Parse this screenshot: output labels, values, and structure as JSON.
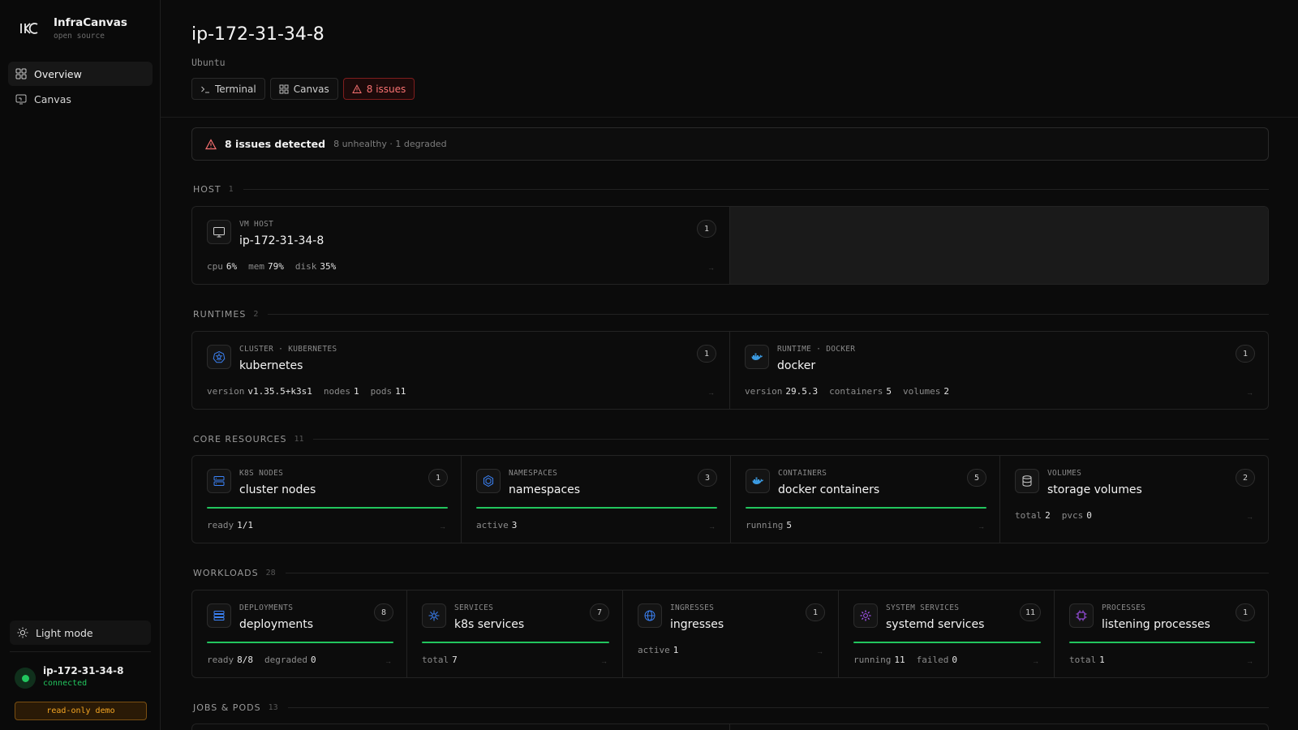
{
  "sidebar": {
    "brand": {
      "name": "InfraCanvas",
      "subtitle": "open source"
    },
    "nav": [
      {
        "label": "Overview",
        "icon": "grid-icon",
        "active": true
      },
      {
        "label": "Canvas",
        "icon": "canvas-icon",
        "active": false
      }
    ],
    "light_mode_label": "Light mode",
    "connection": {
      "host": "ip-172-31-34-8",
      "status": "connected"
    },
    "demo_badge": "read-only demo"
  },
  "header": {
    "title": "ip-172-31-34-8",
    "subtitle": "Ubuntu",
    "actions": [
      {
        "label": "Terminal",
        "icon": "terminal-icon"
      },
      {
        "label": "Canvas",
        "icon": "grid-icon"
      },
      {
        "label": "8 issues",
        "icon": "warning-icon"
      }
    ]
  },
  "banner": {
    "title": "8 issues detected",
    "detail": "8 unhealthy · 1 degraded"
  },
  "sections": {
    "host": {
      "title": "HOST",
      "count": "1",
      "cards": [
        {
          "kind": "VM HOST",
          "name": "ip-172-31-34-8",
          "badge": "1",
          "icon": "monitor-icon",
          "stats": [
            {
              "label": "cpu",
              "value": "6%"
            },
            {
              "label": "mem",
              "value": "79%"
            },
            {
              "label": "disk",
              "value": "35%"
            }
          ]
        }
      ]
    },
    "runtimes": {
      "title": "RUNTIMES",
      "count": "2",
      "cards": [
        {
          "kind": "CLUSTER · KUBERNETES",
          "name": "kubernetes",
          "badge": "1",
          "icon": "kubernetes-icon",
          "stats": [
            {
              "label": "version",
              "value": "v1.35.5+k3s1"
            },
            {
              "label": "nodes",
              "value": "1"
            },
            {
              "label": "pods",
              "value": "11"
            }
          ]
        },
        {
          "kind": "RUNTIME · DOCKER",
          "name": "docker",
          "badge": "1",
          "icon": "docker-icon",
          "stats": [
            {
              "label": "version",
              "value": "29.5.3"
            },
            {
              "label": "containers",
              "value": "5"
            },
            {
              "label": "volumes",
              "value": "2"
            }
          ]
        }
      ]
    },
    "core": {
      "title": "CORE RESOURCES",
      "count": "11",
      "cards": [
        {
          "kind": "K8S NODES",
          "name": "cluster nodes",
          "badge": "1",
          "icon": "server-icon",
          "healthy_fraction": 1.0,
          "stats": [
            {
              "label": "ready",
              "value": "1/1"
            }
          ]
        },
        {
          "kind": "NAMESPACES",
          "name": "namespaces",
          "badge": "3",
          "icon": "hexagon-icon",
          "healthy_fraction": 1.0,
          "stats": [
            {
              "label": "active",
              "value": "3"
            }
          ]
        },
        {
          "kind": "CONTAINERS",
          "name": "docker containers",
          "badge": "5",
          "icon": "docker-icon",
          "healthy_fraction": 1.0,
          "stats": [
            {
              "label": "running",
              "value": "5"
            }
          ]
        },
        {
          "kind": "VOLUMES",
          "name": "storage volumes",
          "badge": "2",
          "icon": "database-icon",
          "stats": [
            {
              "label": "total",
              "value": "2"
            },
            {
              "label": "pvcs",
              "value": "0"
            }
          ]
        }
      ]
    },
    "workloads": {
      "title": "WORKLOADS",
      "count": "28",
      "cards": [
        {
          "kind": "DEPLOYMENTS",
          "name": "deployments",
          "badge": "8",
          "icon": "layers-icon",
          "healthy_fraction": 1.0,
          "stats": [
            {
              "label": "ready",
              "value": "8/8"
            },
            {
              "label": "degraded",
              "value": "0"
            }
          ]
        },
        {
          "kind": "SERVICES",
          "name": "k8s services",
          "badge": "7",
          "icon": "kubernetes-icon",
          "healthy_fraction": 1.0,
          "stats": [
            {
              "label": "total",
              "value": "7"
            }
          ]
        },
        {
          "kind": "INGRESSES",
          "name": "ingresses",
          "badge": "1",
          "icon": "globe-icon",
          "stats": [
            {
              "label": "active",
              "value": "1"
            }
          ]
        },
        {
          "kind": "SYSTEM SERVICES",
          "name": "systemd services",
          "badge": "11",
          "icon": "cog-icon",
          "healthy_fraction": 1.0,
          "stats": [
            {
              "label": "running",
              "value": "11"
            },
            {
              "label": "failed",
              "value": "0"
            }
          ]
        },
        {
          "kind": "PROCESSES",
          "name": "listening processes",
          "badge": "1",
          "icon": "cpu-icon",
          "healthy_fraction": 1.0,
          "stats": [
            {
              "label": "total",
              "value": "1"
            }
          ]
        }
      ]
    },
    "jobs": {
      "title": "JOBS & PODS",
      "count": "13"
    }
  },
  "colors": {
    "healthy": "#22c55e",
    "danger": "#f87171",
    "warning": "#f5a623",
    "accent_blue": "#3b82f6",
    "accent_purple": "#a855f7"
  }
}
